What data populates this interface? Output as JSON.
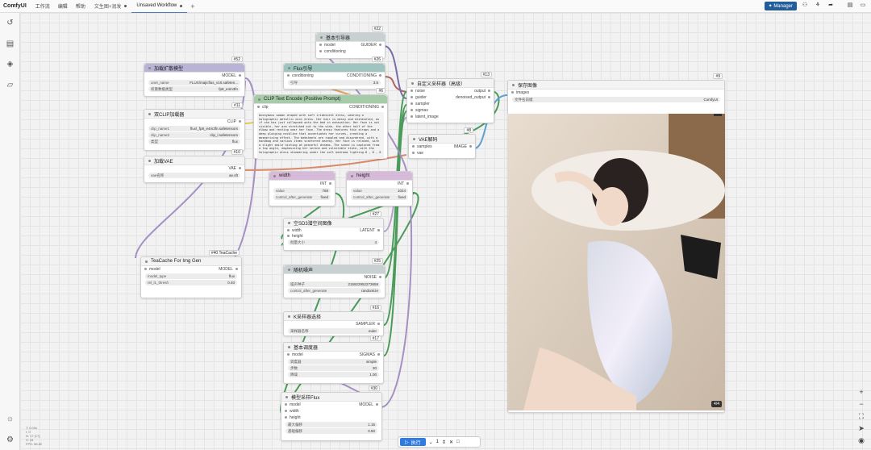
{
  "app": {
    "title": "ComfyUI"
  },
  "menu": [
    "工作流",
    "编辑",
    "帮助"
  ],
  "tabs": [
    {
      "label": "文生图+润发",
      "active": false
    },
    {
      "label": "Unsaved Workflow",
      "active": true
    }
  ],
  "topright": {
    "manager": "Manager"
  },
  "colors": {
    "accent": "#2f7be0",
    "manager": "#235c9a"
  },
  "nodes": {
    "guider": {
      "id": "#22",
      "title": "基本引导器",
      "in1": "model",
      "in2": "conditioning",
      "out": "GUIDER"
    },
    "flux": {
      "id": "#26",
      "title": "Flux引导",
      "in1": "conditioning",
      "out": "CONDITIONING",
      "w_label": "引导",
      "w_value": "3.5"
    },
    "loadmodel": {
      "id": "#52",
      "title": "加载扩散模型",
      "out": "MODEL",
      "w1_label": "unet_name",
      "w1_value": "FLUX/majicflus_v10.safeten...",
      "w2_label": "权重数据类型",
      "w2_value": "fp8_e4m3fn"
    },
    "dualclip": {
      "id": "#11",
      "title": "双CLIP加载器",
      "out": "CLIP",
      "w1_label": "clip_name1",
      "w1_value": "flux\\_fp8_e4m3fn.safetensors",
      "w2_label": "clip_name2",
      "w2_value": "clip_l.safetensors",
      "w3_label": "类型",
      "w3_value": "flux"
    },
    "clipenc": {
      "id": "#6",
      "title": "CLIP Text Encode (Positive Prompt)",
      "in1": "clip",
      "out": "CONDITIONING",
      "prompt": "Anonymous woman draped with soft iridescent dress, wearing a holographic metallic mini dress. Her hair is messy and disheveled, as if she has just collapsed onto the bed in exhaustion. Her face is not visible, her arm stretched out to the side, the other half of the elbow and resting near her face. The dress features thin straps and a deep plunging neckline that accentuates her curves, creating a mesmerizing effect. The bedsheets are rumpled and disordered, with a handbag and various items scattered nearby. Her face is relaxed, with a slight smile hinting at peaceful dreams. The scene is captured from a top angle, emphasizing her serene and vulnerable state, with the holographic dress shimmering under the soft bedroom lighting.8 , 8 , 8"
    },
    "sampler_adv": {
      "id": "#13",
      "title": "自定义采样器（高级）",
      "in1": "noise",
      "in2": "guider",
      "in3": "sampler",
      "in4": "sigmas",
      "in5": "latent_image",
      "out1": "output",
      "out2": "denoised_output"
    },
    "vaedecode": {
      "id": "#8",
      "title": "VAE解码",
      "in1": "samples",
      "in2": "vae",
      "out": "IMAGE"
    },
    "loadvae": {
      "id": "#10",
      "title": "加载VAE",
      "out": "VAE",
      "w1_label": "vae名称",
      "w1_value": "ae.sft"
    },
    "width": {
      "title": "width",
      "out": "INT",
      "w1_label": "value",
      "w1_value": "768",
      "w2_label": "control_after_generate",
      "w2_value": "fixed"
    },
    "height": {
      "title": "height",
      "out": "INT",
      "w1_label": "value",
      "w1_value": "1024",
      "w2_label": "control_after_generate",
      "w2_value": "fixed"
    },
    "emptylatent": {
      "id": "#27",
      "title": "空SD3潜空间图像",
      "in1": "width",
      "in2": "height",
      "out": "LATENT",
      "w1_label": "批量大小",
      "w1_value": "4"
    },
    "teacache": {
      "id": "#40 TeaCache",
      "title": "TeaCache For Img Gen",
      "in1": "model",
      "out": "MODEL",
      "w1_label": "model_type",
      "w1_value": "flux",
      "w2_label": "rel_l1_thresh",
      "w2_value": "0.40"
    },
    "noise": {
      "id": "#25",
      "title": "随机噪声",
      "out": "NOISE",
      "w1_label": "噪声种子",
      "w1_value": "215922952273659",
      "w2_label": "control_after_generate",
      "w2_value": "randomize"
    },
    "ksampler": {
      "id": "#16",
      "title": "K采样器选择",
      "out": "SAMPLER",
      "w1_label": "采样器名称",
      "w1_value": "euler"
    },
    "scheduler": {
      "id": "#17",
      "title": "基本调度器",
      "in1": "model",
      "out": "SIGMAS",
      "w1_label": "调度器",
      "w1_value": "simple",
      "w2_label": "步数",
      "w2_value": "30",
      "w3_label": "降噪",
      "w3_value": "1.00"
    },
    "modelsampling": {
      "id": "#30",
      "title": "模型采样Flux",
      "in1": "model",
      "in2": "width",
      "in3": "height",
      "out": "MODEL",
      "w1_label": "最大偏移",
      "w1_value": "1.15",
      "w2_label": "基础偏移",
      "w2_value": "0.50"
    },
    "save": {
      "id": "#9",
      "title": "保存图像",
      "in1": "images",
      "w1_label": "文件名前缀",
      "w1_value": "ComfyUI",
      "counter": "4/4"
    }
  },
  "runbar": {
    "run_label": "执行",
    "count": "1"
  },
  "stats": {
    "l1": "T: 0.00s",
    "l2": "I: 0",
    "l3": "N: 17 [17]",
    "l4": "V: 33",
    "l5": "FPS: 58.82"
  }
}
